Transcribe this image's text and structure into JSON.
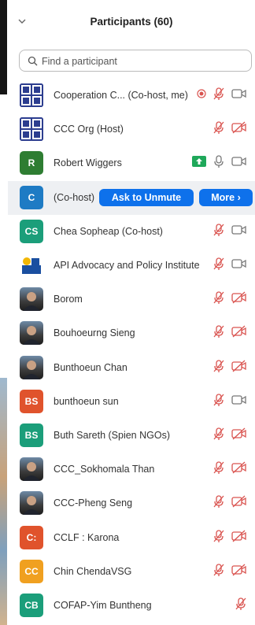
{
  "header": {
    "title": "Participants (60)"
  },
  "search": {
    "placeholder": "Find a participant"
  },
  "hover_actions": {
    "ask_to_unmute": "Ask to Unmute",
    "more": "More ›"
  },
  "colors": {
    "accent": "#0e71eb",
    "muted_red": "#d9534f",
    "share_green": "#1fa85a"
  },
  "participants": [
    {
      "name": "Cooperation C... (Co-host, me)",
      "avatar": "ccc-logo",
      "status": [
        "recording-icon",
        "mic-muted-icon",
        "video-on-icon"
      ]
    },
    {
      "name": "CCC Org (Host)",
      "avatar": "ccc-logo",
      "status": [
        "mic-muted-icon",
        "video-off-icon"
      ]
    },
    {
      "name": "Robert Wiggers",
      "initials": "R",
      "color": "#2e7d32",
      "status": [
        "share-screen-icon",
        "mic-on-icon",
        "video-on-icon"
      ]
    },
    {
      "name": "(Co-host)",
      "initials": "C",
      "color": "#1e7bc4",
      "status": []
    },
    {
      "name": "Chea Sopheap (Co-host)",
      "initials": "CS",
      "color": "#1b9e7a",
      "status": [
        "mic-muted-icon",
        "video-on-icon"
      ]
    },
    {
      "name": "API Advocacy and Policy Institute",
      "avatar": "api-logo",
      "status": [
        "mic-muted-icon",
        "video-on-icon"
      ]
    },
    {
      "name": "Borom",
      "avatar": "photo",
      "status": [
        "mic-muted-icon",
        "video-off-icon"
      ]
    },
    {
      "name": "Bouhoeurng Sieng",
      "avatar": "photo",
      "status": [
        "mic-muted-icon",
        "video-off-icon"
      ]
    },
    {
      "name": "Bunthoeun Chan",
      "avatar": "photo",
      "status": [
        "mic-muted-icon",
        "video-off-icon"
      ]
    },
    {
      "name": "bunthoeun sun",
      "initials": "BS",
      "color": "#e0532c",
      "status": [
        "mic-muted-icon",
        "video-on-icon"
      ]
    },
    {
      "name": "Buth Sareth (Spien NGOs)",
      "initials": "BS",
      "color": "#1b9e7a",
      "status": [
        "mic-muted-icon",
        "video-off-icon"
      ]
    },
    {
      "name": "CCC_Sokhomala Than",
      "avatar": "photo",
      "status": [
        "mic-muted-icon",
        "video-off-icon"
      ]
    },
    {
      "name": "CCC-Pheng Seng",
      "avatar": "photo",
      "status": [
        "mic-muted-icon",
        "video-off-icon"
      ]
    },
    {
      "name": "CCLF : Karona",
      "initials": "C:",
      "color": "#e0532c",
      "status": [
        "mic-muted-icon",
        "video-off-icon"
      ]
    },
    {
      "name": "Chin ChendaVSG",
      "initials": "CC",
      "color": "#f0a020",
      "status": [
        "mic-muted-icon",
        "video-off-icon"
      ]
    },
    {
      "name": "COFAP-Yim Buntheng",
      "initials": "CB",
      "color": "#1b9e7a",
      "status": [
        "mic-muted-icon"
      ]
    }
  ]
}
